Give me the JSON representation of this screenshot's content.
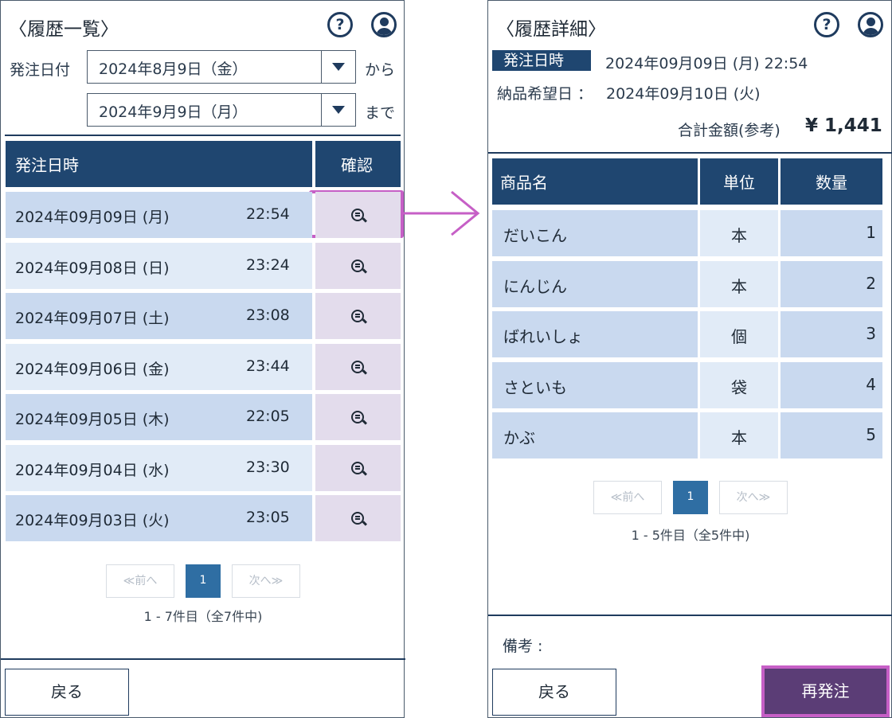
{
  "left": {
    "title": "〈履歴一覧〉",
    "filter": {
      "label": "発注日付",
      "from_value": "2024年8月9日（金）",
      "from_suffix": "から",
      "to_value": "2024年9月9日（月）",
      "to_suffix": "まで"
    },
    "table": {
      "col_datetime": "発注日時",
      "col_confirm": "確認",
      "rows": [
        {
          "date": "2024年09月09日 (月)",
          "time": "22:54"
        },
        {
          "date": "2024年09月08日 (日)",
          "time": "23:24"
        },
        {
          "date": "2024年09月07日 (土)",
          "time": "23:08"
        },
        {
          "date": "2024年09月06日 (金)",
          "time": "23:44"
        },
        {
          "date": "2024年09月05日 (木)",
          "time": "22:05"
        },
        {
          "date": "2024年09月04日 (水)",
          "time": "23:30"
        },
        {
          "date": "2024年09月03日 (火)",
          "time": "23:05"
        }
      ]
    },
    "pagination": {
      "prev": "≪前へ",
      "current": "1",
      "next": "次へ≫",
      "summary": "1 - 7件目（全7件中)"
    },
    "back_button": "戻る"
  },
  "right": {
    "title": "〈履歴詳細〉",
    "order_badge": "発注日時",
    "order_datetime": "2024年09月09日 (月) 22:54",
    "delivery_label": "納品希望日 ：",
    "delivery_date": "2024年09月10日 (火)",
    "total_label": "合計金額(参考)",
    "total_value": "¥ 1,441",
    "table": {
      "col_name": "商品名",
      "col_unit": "単位",
      "col_qty": "数量",
      "rows": [
        {
          "name": "だいこん",
          "unit": "本",
          "qty": "1"
        },
        {
          "name": "にんじん",
          "unit": "本",
          "qty": "2"
        },
        {
          "name": "ばれいしょ",
          "unit": "個",
          "qty": "3"
        },
        {
          "name": "さといも",
          "unit": "袋",
          "qty": "4"
        },
        {
          "name": "かぶ",
          "unit": "本",
          "qty": "5"
        }
      ]
    },
    "pagination": {
      "prev": "≪前へ",
      "current": "1",
      "next": "次へ≫",
      "summary": "1 - 5件目（全5件中)"
    },
    "remarks_label": "備考 :",
    "back_button": "戻る",
    "reorder_button": "再発注"
  },
  "icons": {
    "help": "help-icon",
    "user": "user-icon",
    "zoom": "zoom-detail-icon",
    "dropdown": "chevron-down-icon",
    "arrow": "arrow-right-icon"
  },
  "colors": {
    "header_bg": "#1f4670",
    "row_bg": "#c9d9ef",
    "row_alt_bg": "#e1ebf7",
    "confirm_bg": "#e3dcec",
    "highlight": "#c65fc6",
    "reorder_bg": "#5b3d76",
    "page_current": "#2f6ea3"
  }
}
